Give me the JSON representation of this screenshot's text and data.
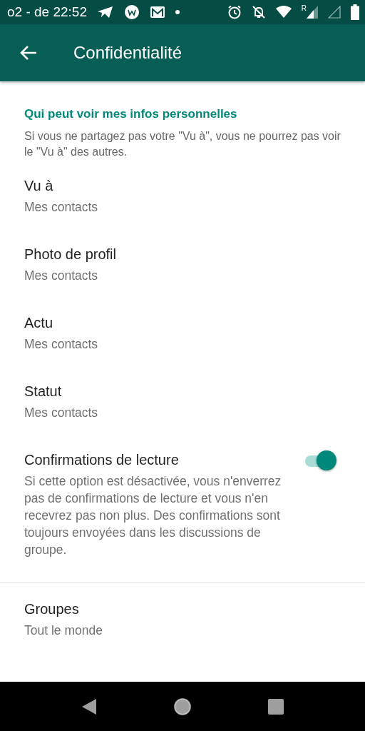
{
  "status_bar": {
    "carrier_time": "o2 - de 22:52",
    "roaming": "R"
  },
  "app_bar": {
    "title": "Confidentialité"
  },
  "sections": [
    {
      "header": "Qui peut voir mes infos personnelles",
      "description": "Si vous ne partagez pas votre \"Vu à\", vous ne pourrez pas voir le \"Vu à\" des autres.",
      "items": [
        {
          "kind": "choice",
          "title": "Vu à",
          "value": "Mes contacts"
        },
        {
          "kind": "choice",
          "title": "Photo de profil",
          "value": "Mes contacts"
        },
        {
          "kind": "choice",
          "title": "Actu",
          "value": "Mes contacts"
        },
        {
          "kind": "choice",
          "title": "Statut",
          "value": "Mes contacts"
        },
        {
          "kind": "toggle",
          "title": "Confirmations de lecture",
          "value": "Si cette option est désactivée, vous n'enverrez pas de confirmations de lecture et vous n'en recevrez pas non plus. Des confirmations sont toujours envoyées dans les discussions de groupe.",
          "on": true
        }
      ]
    },
    {
      "items": [
        {
          "kind": "choice",
          "title": "Groupes",
          "value": "Tout le monde"
        }
      ]
    }
  ]
}
